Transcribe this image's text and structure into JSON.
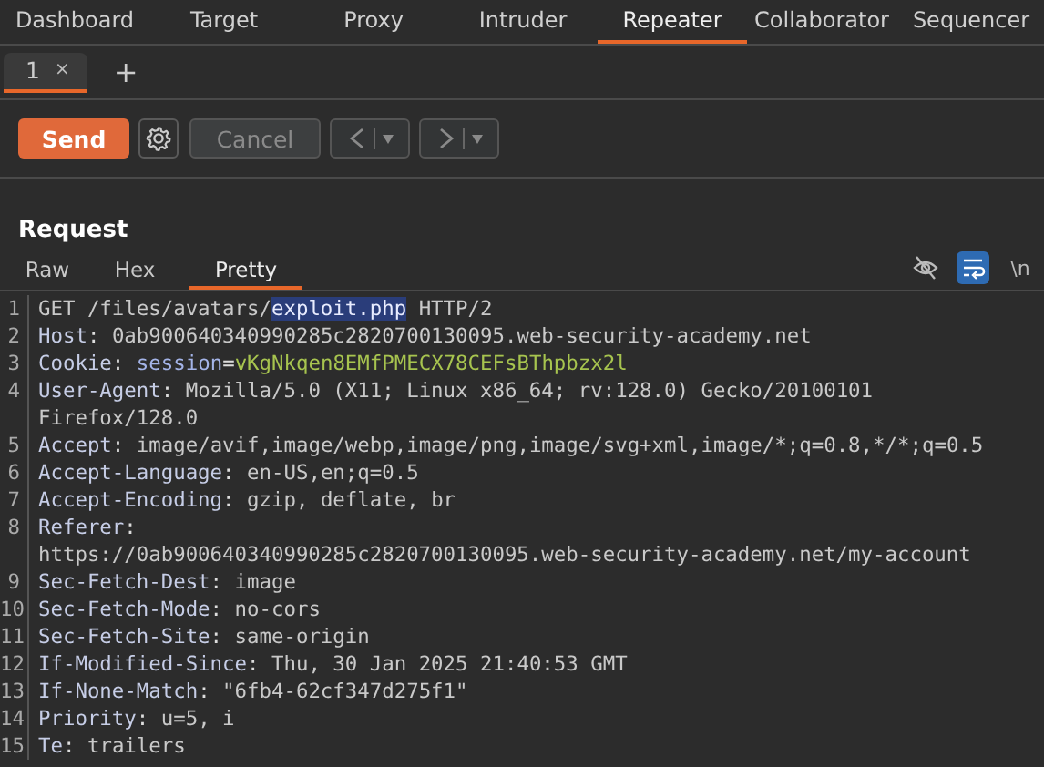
{
  "main_tabs": [
    {
      "label": "Dashboard",
      "selected": false
    },
    {
      "label": "Target",
      "selected": false
    },
    {
      "label": "Proxy",
      "selected": false
    },
    {
      "label": "Intruder",
      "selected": false
    },
    {
      "label": "Repeater",
      "selected": true
    },
    {
      "label": "Collaborator",
      "selected": false
    },
    {
      "label": "Sequencer",
      "selected": false
    }
  ],
  "repeater_tabs": [
    {
      "label": "1",
      "close": "×",
      "selected": true
    }
  ],
  "new_tab": "+",
  "toolbar": [
    {
      "kind": "send",
      "label": "Send"
    },
    {
      "kind": "settings"
    },
    {
      "kind": "cancel",
      "label": "Cancel",
      "disabled": true
    },
    {
      "kind": "back",
      "disabled": true
    },
    {
      "kind": "forward",
      "disabled": true
    }
  ],
  "request": {
    "title": "Request",
    "view_tabs": [
      {
        "label": "Raw",
        "selected": false
      },
      {
        "label": "Hex",
        "selected": false
      },
      {
        "label": "Pretty",
        "selected": true
      }
    ],
    "view_toggles": [
      {
        "kind": "hide",
        "selected": false
      },
      {
        "kind": "wrap",
        "selected": true
      },
      {
        "kind": "newline",
        "label": "\\n",
        "selected": false
      }
    ],
    "lines": [
      {
        "number": "1",
        "parts": [
          {
            "kind": "text",
            "text": "GET /files/avatars/"
          },
          {
            "kind": "selected",
            "text": "exploit.php"
          },
          {
            "kind": "text",
            "text": " HTTP/2"
          }
        ]
      },
      {
        "number": "2",
        "parts": [
          {
            "kind": "header",
            "text": "Host"
          },
          {
            "kind": "punct",
            "text": ": "
          },
          {
            "kind": "text",
            "text": "0ab900640340990285c2820700130095.web-security-academy.net"
          }
        ]
      },
      {
        "number": "3",
        "parts": [
          {
            "kind": "header",
            "text": "Cookie"
          },
          {
            "kind": "punct",
            "text": ": "
          },
          {
            "kind": "cookie_name",
            "text": "session"
          },
          {
            "kind": "punct",
            "text": "="
          },
          {
            "kind": "cookie_value",
            "text": "vKgNkqen8EMfPMECX78CEFsBThpbzx2l"
          }
        ]
      },
      {
        "number": "4",
        "parts": [
          {
            "kind": "header",
            "text": "User-Agent"
          },
          {
            "kind": "punct",
            "text": ": "
          },
          {
            "kind": "text",
            "text": "Mozilla/5.0 (X11; Linux x86_64; rv:128.0) Gecko/20100101"
          }
        ],
        "continuation": "Firefox/128.0"
      },
      {
        "number": "5",
        "parts": [
          {
            "kind": "header",
            "text": "Accept"
          },
          {
            "kind": "punct",
            "text": ": "
          },
          {
            "kind": "text",
            "text": "image/avif,image/webp,image/png,image/svg+xml,image/*;q=0.8,*/*;q=0.5"
          }
        ]
      },
      {
        "number": "6",
        "parts": [
          {
            "kind": "header",
            "text": "Accept-Language"
          },
          {
            "kind": "punct",
            "text": ": "
          },
          {
            "kind": "text",
            "text": "en-US,en;q=0.5"
          }
        ]
      },
      {
        "number": "7",
        "parts": [
          {
            "kind": "header",
            "text": "Accept-Encoding"
          },
          {
            "kind": "punct",
            "text": ": "
          },
          {
            "kind": "text",
            "text": "gzip, deflate, br"
          }
        ]
      },
      {
        "number": "8",
        "parts": [
          {
            "kind": "header",
            "text": "Referer"
          },
          {
            "kind": "punct",
            "text": ":"
          }
        ],
        "continuation": "https://0ab900640340990285c2820700130095.web-security-academy.net/my-account"
      },
      {
        "number": "9",
        "parts": [
          {
            "kind": "header",
            "text": "Sec-Fetch-Dest"
          },
          {
            "kind": "punct",
            "text": ": "
          },
          {
            "kind": "text",
            "text": "image"
          }
        ]
      },
      {
        "number": "10",
        "parts": [
          {
            "kind": "header",
            "text": "Sec-Fetch-Mode"
          },
          {
            "kind": "punct",
            "text": ": "
          },
          {
            "kind": "text",
            "text": "no-cors"
          }
        ]
      },
      {
        "number": "11",
        "parts": [
          {
            "kind": "header",
            "text": "Sec-Fetch-Site"
          },
          {
            "kind": "punct",
            "text": ": "
          },
          {
            "kind": "text",
            "text": "same-origin"
          }
        ]
      },
      {
        "number": "12",
        "parts": [
          {
            "kind": "header",
            "text": "If-Modified-Since"
          },
          {
            "kind": "punct",
            "text": ": "
          },
          {
            "kind": "text",
            "text": "Thu, 30 Jan 2025 21:40:53 GMT"
          }
        ]
      },
      {
        "number": "13",
        "parts": [
          {
            "kind": "header",
            "text": "If-None-Match"
          },
          {
            "kind": "punct",
            "text": ": "
          },
          {
            "kind": "text",
            "text": "\"6fb4-62cf347d275f1\""
          }
        ]
      },
      {
        "number": "14",
        "parts": [
          {
            "kind": "header",
            "text": "Priority"
          },
          {
            "kind": "punct",
            "text": ": "
          },
          {
            "kind": "text",
            "text": "u=5, i"
          }
        ]
      },
      {
        "number": "15",
        "parts": [
          {
            "kind": "header",
            "text": "Te"
          },
          {
            "kind": "punct",
            "text": ": "
          },
          {
            "kind": "text",
            "text": "trailers"
          }
        ]
      }
    ]
  }
}
